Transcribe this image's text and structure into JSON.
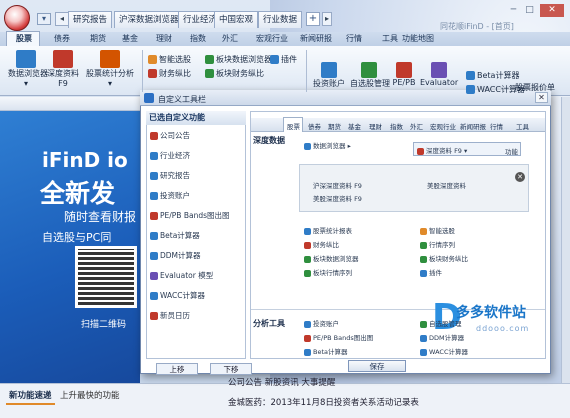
{
  "window": {
    "title": "同花顺iFinD - [首页]",
    "controls": [
      "─",
      "□",
      "✕"
    ]
  },
  "app_button": {
    "icon": "ifind-logo-icon"
  },
  "browser_tabs": [
    "研究报告",
    "沪深数据浏览器",
    "行业经济",
    "中国宏观",
    "行业数据"
  ],
  "browser_tab_add": "+",
  "ribbon_tabs": [
    "股票",
    "债券",
    "期货",
    "基金",
    "理财",
    "指数",
    "外汇",
    "宏观行业",
    "新闻研报",
    "行情",
    "工具",
    "功能地图"
  ],
  "ribbon": {
    "big_tools": [
      {
        "label": "数据浏览器",
        "sub": "▾",
        "icon": "data-browser-icon",
        "color": "#2f7cc7"
      },
      {
        "label": "深度资料",
        "sub": "F9",
        "icon": "deep-info-icon",
        "color": "#c0392b"
      },
      {
        "label": "股票统计分析",
        "sub": "▾",
        "icon": "stock-stat-icon",
        "color": "#d35400"
      }
    ],
    "small_tools": [
      {
        "label": "智能选股",
        "icon": "smart-pick-icon",
        "color": "#e08a2a"
      },
      {
        "label": "板块数据浏览器",
        "icon": "sector-browser-icon",
        "color": "#2f8f3e"
      },
      {
        "label": "插件",
        "icon": "plugin-icon",
        "color": "#2f7cc7"
      },
      {
        "label": "财务纵比",
        "icon": "finance-compare-icon",
        "color": "#c0392b"
      },
      {
        "label": "板块财务纵比",
        "icon": "sector-finance-icon",
        "color": "#2f8f3e"
      }
    ],
    "right_tools": [
      {
        "label": "投资账户",
        "icon": "invest-account-icon",
        "color": "#2f7cc7"
      },
      {
        "label": "自选股管理",
        "icon": "watchlist-icon",
        "color": "#2f8f3e"
      },
      {
        "label": "PE/PB",
        "icon": "pepb-icon",
        "color": "#c0392b"
      },
      {
        "label": "Evaluator",
        "icon": "evaluator-icon",
        "color": "#6a4fb3"
      }
    ],
    "right_small": [
      {
        "label": "Beta计算器",
        "icon": "beta-icon",
        "color": "#2f7cc7"
      },
      {
        "label": "WACC计算器",
        "icon": "wacc-icon",
        "color": "#2f7cc7"
      }
    ],
    "far_right": {
      "label": "股票报价单",
      "icon": "quote-sheet-icon"
    }
  },
  "banner": {
    "line1": "iFinD io",
    "line2": "全新发",
    "line3": "随时查看财报",
    "line4": "自选股与PC同",
    "qr_caption": "扫描二维码"
  },
  "bottom_tabs": [
    "新功能速递",
    "上升最快的功能"
  ],
  "news": {
    "header": "公司公告   新股资讯   大事提醒",
    "item": "金城医药：2013年11月8日投资者关系活动记录表"
  },
  "dialog": {
    "title": "自定义工具栏",
    "close": "✕",
    "list_header": "已选自定义功能",
    "list_items": [
      {
        "label": "公司公告",
        "icon": "announcement-icon",
        "color": "#c0392b"
      },
      {
        "label": "行业经济",
        "icon": "industry-icon",
        "color": "#2f7cc7"
      },
      {
        "label": "研究报告",
        "icon": "research-report-icon",
        "color": "#2f7cc7"
      },
      {
        "label": "投资账户",
        "icon": "invest-account-icon",
        "color": "#2f7cc7"
      },
      {
        "label": "PE/PB Bands图出图",
        "icon": "pepb-bands-icon",
        "color": "#c0392b"
      },
      {
        "label": "Beta计算器",
        "icon": "beta-icon",
        "color": "#2f7cc7"
      },
      {
        "label": "DDM计算器",
        "icon": "ddm-icon",
        "color": "#2f7cc7"
      },
      {
        "label": "Evaluator 模型",
        "icon": "evaluator-icon",
        "color": "#6a4fb3"
      },
      {
        "label": "WACC计算器",
        "icon": "wacc-icon",
        "color": "#2f7cc7"
      },
      {
        "label": "新员日历",
        "icon": "calendar-icon",
        "color": "#c0392b"
      }
    ],
    "up": "上移",
    "down": "下移",
    "save": "保存",
    "tabs": [
      "股票",
      "债券",
      "期货",
      "基金",
      "理财",
      "指数",
      "外汇",
      "宏观行业",
      "新闻研报",
      "行情",
      "工具"
    ],
    "section1": "深度数据",
    "section2": "分析工具",
    "data_browser": "数据浏览器",
    "selector": {
      "label": "深度资料 F9",
      "arrow": "▾",
      "link": "功能"
    },
    "popup_items": [
      "沪深深度资料 F9",
      "美股深度资料",
      "美股深度资料 F9"
    ],
    "popup_close": "✕",
    "grid_left": [
      {
        "label": "股票统计报表",
        "icon": "stat-report-icon",
        "color": "#2f7cc7"
      },
      {
        "label": "财务纵比",
        "icon": "finance-compare-icon",
        "color": "#c0392b"
      },
      {
        "label": "板块数据浏览器",
        "icon": "sector-browser-icon",
        "color": "#2f8f3e"
      },
      {
        "label": "板块行情序列",
        "icon": "sector-quote-icon",
        "color": "#2f8f3e"
      }
    ],
    "grid_right": [
      {
        "label": "智能选股",
        "icon": "smart-pick-icon",
        "color": "#e08a2a"
      },
      {
        "label": "行情序列",
        "icon": "quote-series-icon",
        "color": "#2f8f3e"
      },
      {
        "label": "板块财务纵比",
        "icon": "sector-finance-icon",
        "color": "#2f8f3e"
      },
      {
        "label": "插件",
        "icon": "plugin-icon",
        "color": "#2f7cc7"
      }
    ],
    "tools_left": [
      {
        "label": "投资账户",
        "icon": "invest-account-icon",
        "color": "#2f7cc7"
      },
      {
        "label": "PE/PB Bands图出图",
        "icon": "pepb-bands-icon",
        "color": "#c0392b"
      },
      {
        "label": "Beta计算器",
        "icon": "beta-icon",
        "color": "#2f7cc7"
      }
    ],
    "tools_right": [
      {
        "label": "自选股管理",
        "icon": "watchlist-icon",
        "color": "#2f8f3e"
      },
      {
        "label": "DDM计算器",
        "icon": "ddm-icon",
        "color": "#2f7cc7"
      },
      {
        "label": "WACC计算器",
        "icon": "wacc-icon",
        "color": "#2f7cc7"
      }
    ]
  },
  "watermark": {
    "name": "多多软件站",
    "url": "ddooo.com"
  }
}
